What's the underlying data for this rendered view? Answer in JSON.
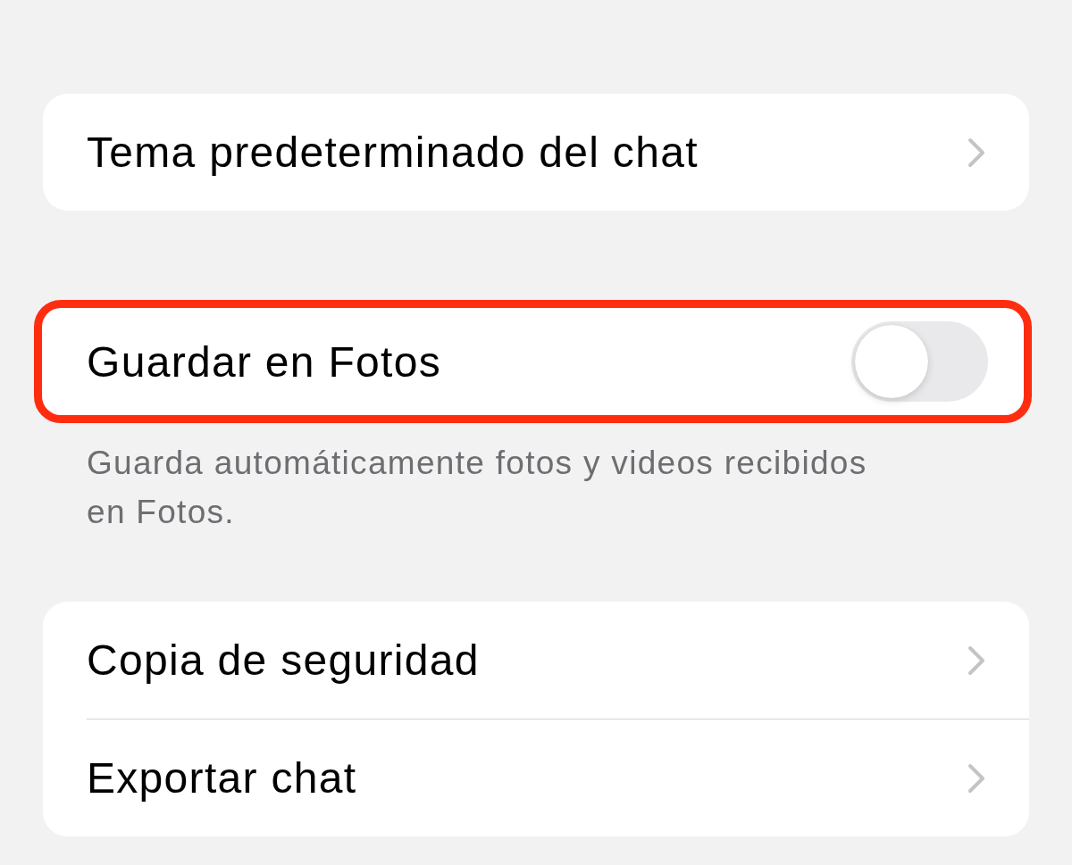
{
  "sections": [
    {
      "highlighted": false,
      "items": [
        {
          "kind": "link",
          "label": "Tema predeterminado del chat"
        }
      ]
    },
    {
      "highlighted": true,
      "items": [
        {
          "kind": "switch",
          "label": "Guardar en Fotos",
          "on": false
        }
      ],
      "footer": "Guarda automáticamente fotos y videos recibidos en Fotos."
    },
    {
      "highlighted": false,
      "items": [
        {
          "kind": "link",
          "label": "Copia de seguridad"
        },
        {
          "kind": "link",
          "label": "Exportar chat"
        }
      ]
    }
  ]
}
